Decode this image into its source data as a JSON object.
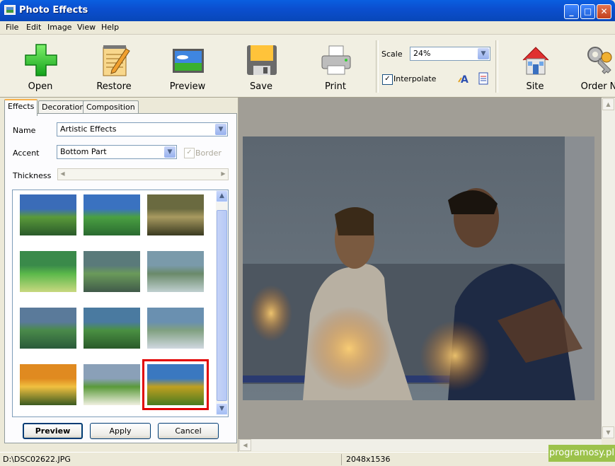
{
  "window": {
    "title": "Photo Effects"
  },
  "menu": [
    "File",
    "Edit",
    "Image",
    "View",
    "Help"
  ],
  "toolbar": {
    "open": "Open",
    "restore": "Restore",
    "preview": "Preview",
    "save": "Save",
    "print": "Print",
    "scale_label": "Scale",
    "scale_value": "24%",
    "interpolate_label": "Interpolate",
    "interpolate_checked": true,
    "site": "Site",
    "order": "Order N"
  },
  "tabs": [
    "Effects",
    "Decoration",
    "Composition"
  ],
  "effects": {
    "name_label": "Name",
    "name_value": "Artistic Effects",
    "accent_label": "Accent",
    "accent_value": "Bottom Part",
    "border_label": "Border",
    "thickness_label": "Thickness",
    "selected_thumbnail": 12
  },
  "buttons": {
    "preview": "Preview",
    "apply": "Apply",
    "cancel": "Cancel"
  },
  "status": {
    "path": "D:\\DSC02622.JPG",
    "size": "2048x1536"
  },
  "watermark": "programosy.pl",
  "colors": {
    "titlebar": "#0a5fe0",
    "selection": "#e10000",
    "watermark": "#9cc24b"
  }
}
